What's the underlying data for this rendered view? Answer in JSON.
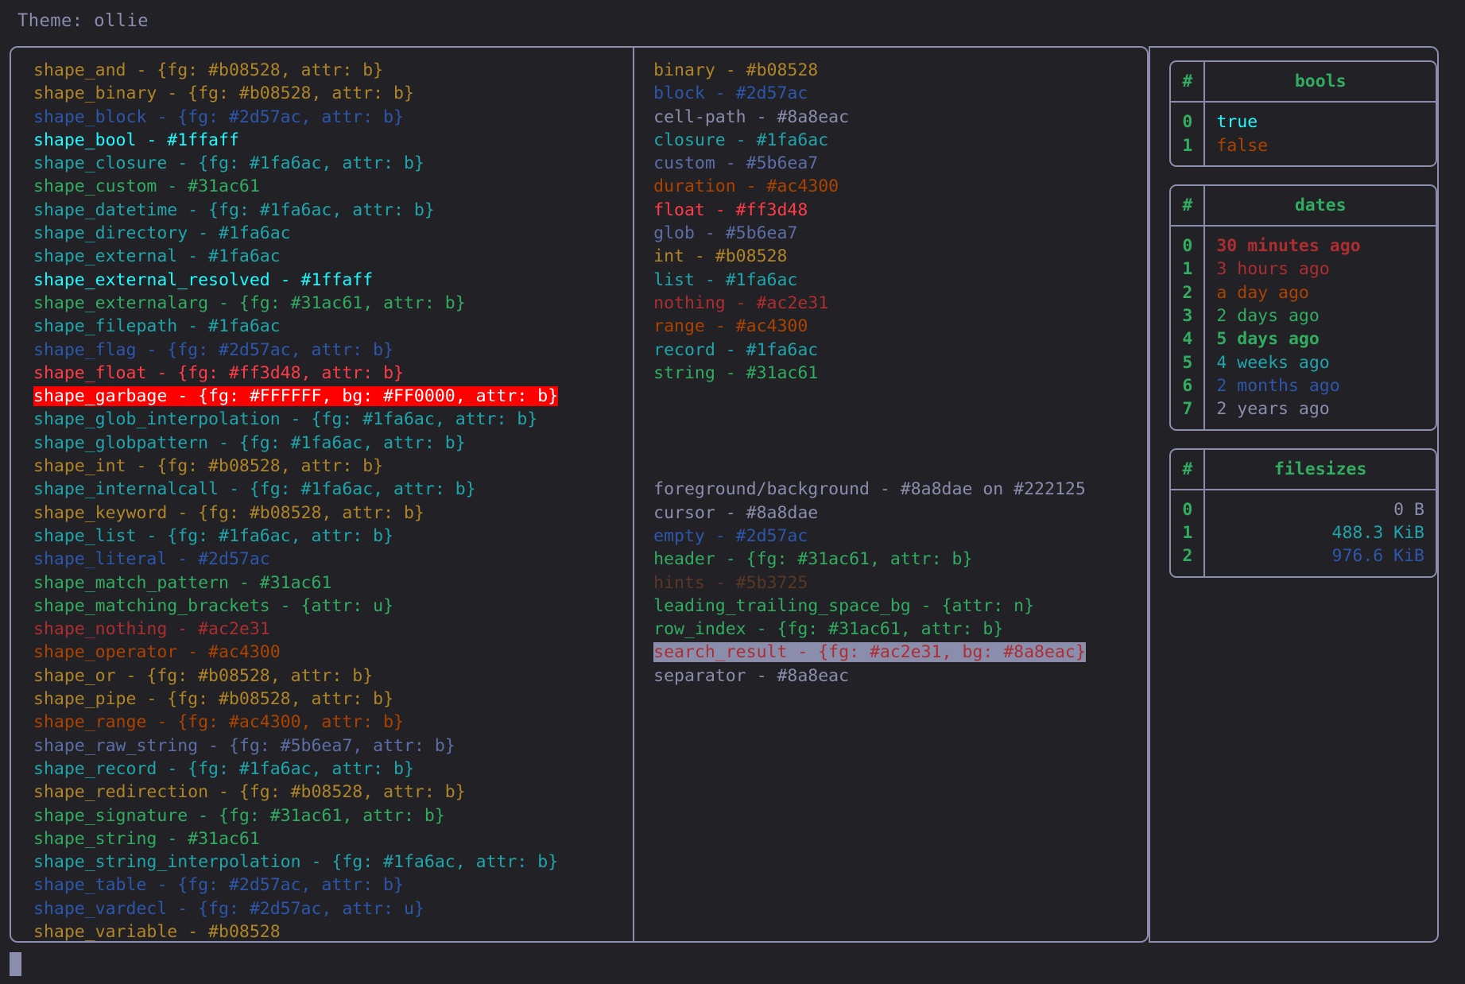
{
  "title": "Theme: ollie",
  "colors": {
    "background": "#222125",
    "foreground": "#8a8dae",
    "border": "#8a8dae",
    "cursor": "#8a8dae",
    "yellow": "#b08528",
    "blue": "#2d57ac",
    "cyan_bright": "#1ffaff",
    "teal": "#1fa6ac",
    "green": "#31ac61",
    "red": "#ff3d48",
    "dark_red": "#ac2e31",
    "orange": "#ac4300",
    "slate": "#5b6ea7",
    "brown": "#5b3725",
    "white": "#FFFFFF",
    "pure_red_bg": "#FF0000"
  },
  "shapes_panel": {
    "lines": [
      {
        "text": "shape_and - {fg: #b08528, attr: b}",
        "color": "#b08528",
        "bold": true
      },
      {
        "text": "shape_binary - {fg: #b08528, attr: b}",
        "color": "#b08528",
        "bold": true
      },
      {
        "text": "shape_block - {fg: #2d57ac, attr: b}",
        "color": "#2d57ac",
        "bold": true
      },
      {
        "text": "shape_bool - #1ffaff",
        "color": "#1ffaff",
        "bold": false
      },
      {
        "text": "shape_closure - {fg: #1fa6ac, attr: b}",
        "color": "#1fa6ac",
        "bold": true
      },
      {
        "text": "shape_custom - #31ac61",
        "color": "#31ac61",
        "bold": false
      },
      {
        "text": "shape_datetime - {fg: #1fa6ac, attr: b}",
        "color": "#1fa6ac",
        "bold": true
      },
      {
        "text": "shape_directory - #1fa6ac",
        "color": "#1fa6ac",
        "bold": false
      },
      {
        "text": "shape_external - #1fa6ac",
        "color": "#1fa6ac",
        "bold": false
      },
      {
        "text": "shape_external_resolved - #1ffaff",
        "color": "#1ffaff",
        "bold": true
      },
      {
        "text": "shape_externalarg - {fg: #31ac61, attr: b}",
        "color": "#31ac61",
        "bold": true
      },
      {
        "text": "shape_filepath - #1fa6ac",
        "color": "#1fa6ac",
        "bold": false
      },
      {
        "text": "shape_flag - {fg: #2d57ac, attr: b}",
        "color": "#2d57ac",
        "bold": true
      },
      {
        "text": "shape_float - {fg: #ff3d48, attr: b}",
        "color": "#ff3d48",
        "bold": true
      },
      {
        "text": "shape_garbage - {fg: #FFFFFF, bg: #FF0000, attr: b}",
        "color": "#FFFFFF",
        "bg": "#FF0000",
        "bold": true
      },
      {
        "text": "shape_glob_interpolation - {fg: #1fa6ac, attr: b}",
        "color": "#1fa6ac",
        "bold": true
      },
      {
        "text": "shape_globpattern - {fg: #1fa6ac, attr: b}",
        "color": "#1fa6ac",
        "bold": true
      },
      {
        "text": "shape_int - {fg: #b08528, attr: b}",
        "color": "#b08528",
        "bold": true
      },
      {
        "text": "shape_internalcall - {fg: #1fa6ac, attr: b}",
        "color": "#1fa6ac",
        "bold": true
      },
      {
        "text": "shape_keyword - {fg: #b08528, attr: b}",
        "color": "#b08528",
        "bold": true
      },
      {
        "text": "shape_list - {fg: #1fa6ac, attr: b}",
        "color": "#1fa6ac",
        "bold": true
      },
      {
        "text": "shape_literal - #2d57ac",
        "color": "#2d57ac",
        "bold": false
      },
      {
        "text": "shape_match_pattern - #31ac61",
        "color": "#31ac61",
        "bold": false
      },
      {
        "text": "shape_matching_brackets - {attr: u}",
        "color": "#31ac61",
        "bold": false,
        "underline": true
      },
      {
        "text": "shape_nothing - #ac2e31",
        "color": "#ac2e31",
        "bold": false
      },
      {
        "text": "shape_operator - #ac4300",
        "color": "#ac4300",
        "bold": false
      },
      {
        "text": "shape_or - {fg: #b08528, attr: b}",
        "color": "#b08528",
        "bold": true
      },
      {
        "text": "shape_pipe - {fg: #b08528, attr: b}",
        "color": "#b08528",
        "bold": true
      },
      {
        "text": "shape_range - {fg: #ac4300, attr: b}",
        "color": "#ac4300",
        "bold": true
      },
      {
        "text": "shape_raw_string - {fg: #5b6ea7, attr: b}",
        "color": "#5b6ea7",
        "bold": true
      },
      {
        "text": "shape_record - {fg: #1fa6ac, attr: b}",
        "color": "#1fa6ac",
        "bold": true
      },
      {
        "text": "shape_redirection - {fg: #b08528, attr: b}",
        "color": "#b08528",
        "bold": true
      },
      {
        "text": "shape_signature - {fg: #31ac61, attr: b}",
        "color": "#31ac61",
        "bold": true
      },
      {
        "text": "shape_string - #31ac61",
        "color": "#31ac61",
        "bold": false
      },
      {
        "text": "shape_string_interpolation - {fg: #1fa6ac, attr: b}",
        "color": "#1fa6ac",
        "bold": true
      },
      {
        "text": "shape_table - {fg: #2d57ac, attr: b}",
        "color": "#2d57ac",
        "bold": true
      },
      {
        "text": "shape_vardecl - {fg: #2d57ac, attr: u}",
        "color": "#2d57ac",
        "bold": false,
        "underline": true
      },
      {
        "text": "shape_variable - #b08528",
        "color": "#b08528",
        "bold": false
      }
    ]
  },
  "types_panel": {
    "lines": [
      {
        "text": "binary - #b08528",
        "color": "#b08528",
        "bold": false
      },
      {
        "text": "block - #2d57ac",
        "color": "#2d57ac",
        "bold": false
      },
      {
        "text": "cell-path - #8a8eac",
        "color": "#8a8eac",
        "bold": false
      },
      {
        "text": "closure - #1fa6ac",
        "color": "#1fa6ac",
        "bold": false
      },
      {
        "text": "custom - #5b6ea7",
        "color": "#5b6ea7",
        "bold": false
      },
      {
        "text": "duration - #ac4300",
        "color": "#ac4300",
        "bold": false
      },
      {
        "text": "float - #ff3d48",
        "color": "#ff3d48",
        "bold": false
      },
      {
        "text": "glob - #5b6ea7",
        "color": "#5b6ea7",
        "bold": false
      },
      {
        "text": "int - #b08528",
        "color": "#b08528",
        "bold": false
      },
      {
        "text": "list - #1fa6ac",
        "color": "#1fa6ac",
        "bold": false
      },
      {
        "text": "nothing - #ac2e31",
        "color": "#ac2e31",
        "bold": false
      },
      {
        "text": "range - #ac4300",
        "color": "#ac4300",
        "bold": false
      },
      {
        "text": "record - #1fa6ac",
        "color": "#1fa6ac",
        "bold": false
      },
      {
        "text": "string - #31ac61",
        "color": "#31ac61",
        "bold": false
      },
      {
        "text": "",
        "blank": true
      },
      {
        "text": "",
        "blank": true
      },
      {
        "text": "",
        "blank": true
      },
      {
        "text": "",
        "blank": true
      },
      {
        "text": "foreground/background - #8a8dae on #222125",
        "color": "#8a8dae",
        "bold": false
      },
      {
        "text": "cursor - #8a8dae",
        "color": "#8a8dae",
        "bold": false
      },
      {
        "text": "empty - #2d57ac",
        "color": "#2d57ac",
        "bold": false
      },
      {
        "text": "header - {fg: #31ac61, attr: b}",
        "color": "#31ac61",
        "bold": true
      },
      {
        "text": "hints - #5b3725",
        "color": "#5b3725",
        "bold": false
      },
      {
        "text": "leading_trailing_space_bg - {attr: n}",
        "color": "#31ac61",
        "bold": false
      },
      {
        "text": "row_index - {fg: #31ac61, attr: b}",
        "color": "#31ac61",
        "bold": true
      },
      {
        "text": "search_result - {fg: #ac2e31, bg: #8a8eac}",
        "color": "#ac2e31",
        "bg": "#8a8eac",
        "bold": false
      },
      {
        "text": "separator - #8a8eac",
        "color": "#8a8eac",
        "bold": false
      }
    ]
  },
  "tables": [
    {
      "name": "bools",
      "index_header": "#",
      "value_header": "bools",
      "align": "left",
      "rows": [
        {
          "index": "0",
          "value": "true",
          "color": "#1ffaff",
          "bold": false
        },
        {
          "index": "1",
          "value": "false",
          "color": "#ac4300",
          "bold": false
        }
      ]
    },
    {
      "name": "dates",
      "index_header": "#",
      "value_header": "dates",
      "align": "left",
      "rows": [
        {
          "index": "0",
          "value": "30 minutes ago",
          "color": "#ac2e31",
          "bold": true
        },
        {
          "index": "1",
          "value": "3 hours ago",
          "color": "#ac2e31",
          "bold": false
        },
        {
          "index": "2",
          "value": "a day ago",
          "color": "#ac4300",
          "bold": false
        },
        {
          "index": "3",
          "value": "2 days ago",
          "color": "#31ac61",
          "bold": false
        },
        {
          "index": "4",
          "value": "5 days ago",
          "color": "#31ac61",
          "bold": true
        },
        {
          "index": "5",
          "value": "4 weeks ago",
          "color": "#1fa6ac",
          "bold": false
        },
        {
          "index": "6",
          "value": "2 months ago",
          "color": "#2d57ac",
          "bold": false
        },
        {
          "index": "7",
          "value": "2 years ago",
          "color": "#8a8dae",
          "bold": false
        }
      ]
    },
    {
      "name": "filesizes",
      "index_header": "#",
      "value_header": "filesizes",
      "align": "right",
      "rows": [
        {
          "index": "0",
          "value": "0 B",
          "color": "#8a8dae",
          "bold": false
        },
        {
          "index": "1",
          "value": "488.3 KiB",
          "color": "#1fa6ac",
          "bold": false
        },
        {
          "index": "2",
          "value": "976.6 KiB",
          "color": "#2d57ac",
          "bold": false
        }
      ]
    }
  ],
  "cursor": {
    "shape": "block"
  }
}
